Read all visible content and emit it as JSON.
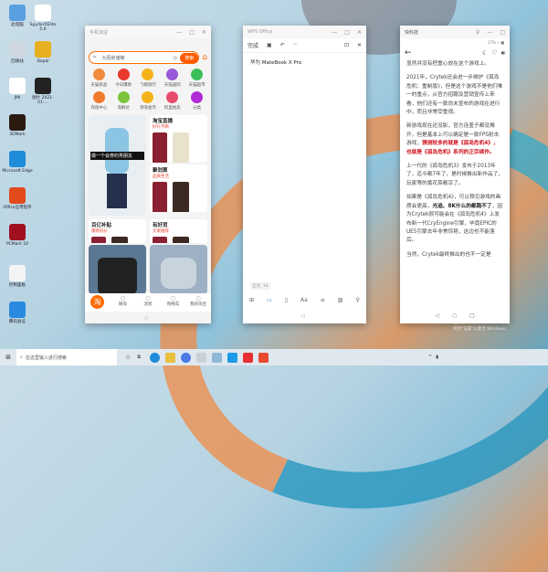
{
  "desktop": {
    "icons": [
      {
        "label": "此电脑",
        "color": "#5aa0e0"
      },
      {
        "label": "SpyderXElite 5.6",
        "color": "#ffffff"
      },
      {
        "label": "回收站",
        "color": "#cfd8e0"
      },
      {
        "label": "Dopal",
        "color": "#e8b020"
      },
      {
        "label": "JMI",
        "color": "#ffffff"
      },
      {
        "label": "图片 2021-01-...",
        "color": "#222222"
      },
      {
        "label": "3DMark",
        "color": "#2a1a10"
      },
      {
        "label": "Microsoft Edge",
        "color": "#1e8cd8"
      },
      {
        "label": "Office应用程序",
        "color": "#e24a1c"
      },
      {
        "label": "PCMark 10",
        "color": "#a01020"
      },
      {
        "label": "控制面板",
        "color": "#f4f4f4"
      },
      {
        "label": "腾讯会议",
        "color": "#2a8ae0"
      }
    ]
  },
  "taobao": {
    "title": "手机淘宝",
    "search_placeholder": "大厨房储罐",
    "search_button": "搜索",
    "shortcuts": [
      "天猫新品",
      "今日爆款",
      "飞猪旅行",
      "天猫国际",
      "天猫超市",
      "充值中心",
      "淘鲜达",
      "领淘金币",
      "阿里拍卖",
      "分类"
    ],
    "shortcut_colors": [
      "#f08a3c",
      "#e8382c",
      "#f4b21a",
      "#9a5ad8",
      "#3cbf5a",
      "#f07a2c",
      "#7cc43c",
      "#f4b21a",
      "#e84c6c",
      "#b02cd8"
    ],
    "banner_text": "做一个会穿的男朋友",
    "cards": [
      {
        "title": "淘宝直播",
        "sub": "好礼不断"
      },
      {
        "title": "聚划算",
        "sub": "品质生活"
      },
      {
        "title": "百亿补贴",
        "sub": "爆款低价"
      },
      {
        "title": "有好货",
        "sub": "大家推荐"
      }
    ],
    "tabs": [
      "淘",
      "微淘",
      "消息",
      "购物车",
      "我的淘宝"
    ]
  },
  "wps": {
    "title": "WPS Office",
    "done": "完成",
    "doc_text": "华为 MateBook X Pro",
    "word_count": "全文: 14"
  },
  "article": {
    "title": "快科技",
    "status": "17% ⚡ ■",
    "paragraphs": [
      {
        "parts": [
          {
            "t": "显然并没有把重心放在这个游戏上。"
          }
        ]
      },
      {
        "parts": [
          {
            "t": "2021年，Crytek还会进一步维护《孤岛危机：重制版》，但是这个游戏不是他们唯一的重点，从官方招聘及营销宣传上来看，他们还有一款尚未宣布的游戏在进行中，而且非常受重视。"
          }
        ]
      },
      {
        "parts": [
          {
            "t": "新游戏现在还没影，官方连盖子都没揭开，但是基本上可以确定是一款FPS射击游戏，"
          },
          {
            "t": "猜测较多的就是《孤岛危机4》，也就是《孤岛危机》系列的正宗续作。",
            "s": "red"
          }
        ]
      },
      {
        "parts": [
          {
            "t": "上一代的《孤岛危机3》发布于2013年了，迄今都7年了，是时候推出新作品了，玩家等的黄花菜都凉了。"
          }
        ]
      },
      {
        "parts": [
          {
            "t": "如果是《孤岛危机4》，可以预见游戏的画质会更高，"
          },
          {
            "t": "光追、8K什么的都跑不了",
            "s": "b"
          },
          {
            "t": "，因为Crytek很可能会在《孤岛危机4》上发布新一代CryEngine引擎，毕竟EPIC的UE5引擎去年非常惊艳，这边也不能落后。"
          }
        ]
      },
      {
        "parts": [
          {
            "t": "当然，Crytek最终推出的也不一定是"
          }
        ]
      }
    ]
  },
  "taskbar": {
    "search_placeholder": "在这里输入进行搜索"
  },
  "watermark": {
    "line1": "激活 Windows",
    "line2": "转到\"设置\"以激活 Windows。"
  }
}
